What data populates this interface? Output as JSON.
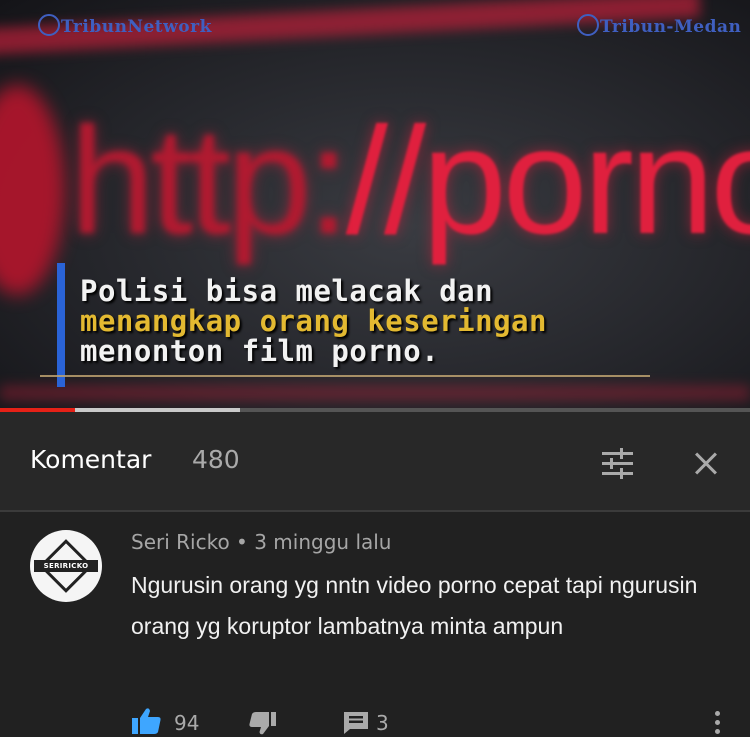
{
  "video": {
    "watermark_left": "TribunNetwork",
    "watermark_right": "Tribun-Medan",
    "background_text_dim": "http:",
    "background_text": "//porno",
    "caption_line1": "Polisi bisa melacak dan",
    "caption_line2": "menangkap orang keseringan",
    "caption_line3": "menonton film porno.",
    "progress_fraction": 0.1,
    "buffered_fraction": 0.32
  },
  "comments": {
    "title": "Komentar",
    "count": "480",
    "sort_icon": "sort-filter-icon",
    "close_icon": "close-icon"
  },
  "comment": {
    "avatar_text": "SERIRICKO",
    "author": "Seri Ricko",
    "separator": " • ",
    "time": "3 minggu lalu",
    "text": "Ngurusin orang yg nntn video porno cepat tapi ngurusin orang yg koruptor lambatnya minta ampun",
    "likes": "94",
    "replies": "3"
  },
  "colors": {
    "accent_blue": "#3ea6ff",
    "progress_red": "#e62117",
    "caption_yellow": "#e3b931",
    "url_red": "#e0203e"
  }
}
